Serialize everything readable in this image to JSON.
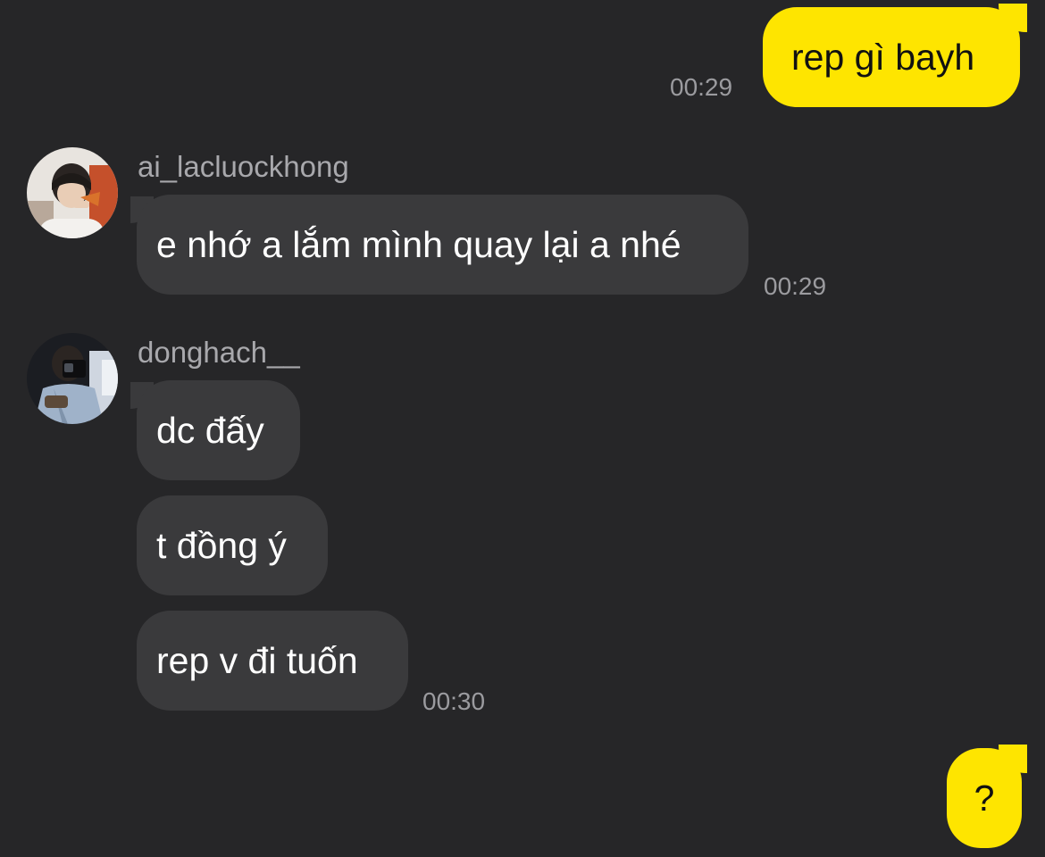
{
  "messages": {
    "m1": {
      "text": "rep gì bayh",
      "time": "00:29"
    },
    "m2": {
      "sender": "ai_lacluockhong",
      "text": "e nhớ a lắm mình quay lại a nhé",
      "time": "00:29"
    },
    "m3": {
      "sender": "donghach__",
      "texts": [
        "dc đấy",
        "t đồng ý",
        "rep v đi tuốn"
      ],
      "time": "00:30"
    },
    "m4": {
      "text": "?"
    }
  },
  "colors": {
    "background": "#262628",
    "outgoing_bubble": "#fee500",
    "incoming_bubble": "#3a3a3c",
    "timestamp": "#9b9b9f"
  },
  "icons": {
    "avatar_1": "avatar-photo-boy-eating-pizza",
    "avatar_2": "avatar-photo-boy-mirror-selfie"
  }
}
